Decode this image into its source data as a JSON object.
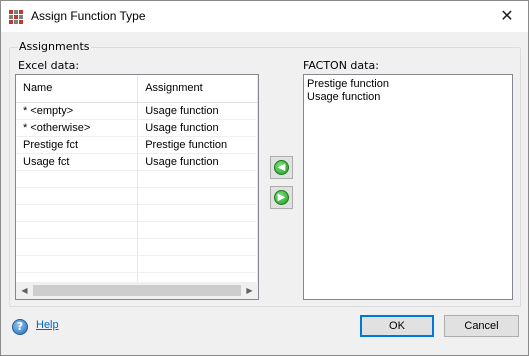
{
  "window": {
    "title": "Assign Function Type",
    "close_glyph": "✕"
  },
  "assignments": {
    "group_label": "Assignments",
    "excel_label": "Excel data:",
    "facton_label": "FACTON data:",
    "columns": [
      "Name",
      "Assignment"
    ],
    "rows": [
      [
        "* <empty>",
        "Usage function"
      ],
      [
        "* <otherwise>",
        "Usage function"
      ],
      [
        "Prestige fct",
        "Prestige function"
      ],
      [
        "Usage fct",
        "Usage function"
      ]
    ],
    "facton_items": [
      "Prestige function",
      "Usage function"
    ]
  },
  "transfer": {
    "left_icon": "arrow-left-green-icon",
    "right_icon": "arrow-right-green-icon",
    "left_glyph": "◀",
    "right_glyph": "▶"
  },
  "footer": {
    "help_label": "Help",
    "ok_label": "OK",
    "cancel_label": "Cancel"
  },
  "colors": {
    "accent": "#0078d7",
    "link": "#0066cc",
    "arrow_green": "#2aa52a"
  }
}
